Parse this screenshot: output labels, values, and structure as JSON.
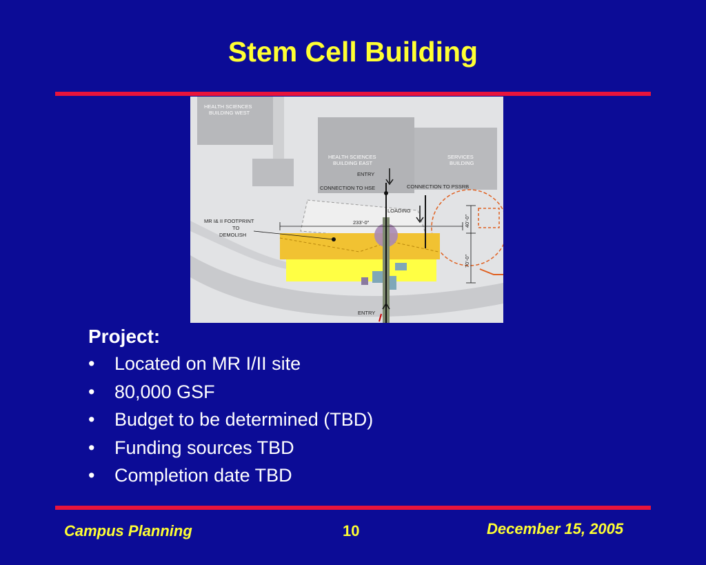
{
  "slide": {
    "title": "Stem Cell Building"
  },
  "site_plan": {
    "labels": {
      "hs_west_1": "HEALTH SCIENCES",
      "hs_west_2": "BUILDING WEST",
      "hs_east_1": "HEALTH SCIENCES",
      "hs_east_2": "BUILDING EAST",
      "services_1": "SERVICES",
      "services_2": "BUILDING",
      "entry_top": "ENTRY",
      "connection_hse": "CONNECTION TO HSE",
      "connection_pssrb": "CONNECTION TO PSSRB",
      "loading": "LOADING",
      "footprint_1": "MR I& II FOOTPRINT",
      "footprint_2": "TO",
      "footprint_3": "DEMOLISH",
      "dimension_width": "233'-0\"",
      "dimension_right_1": "40'-0\"",
      "dimension_right_2": "70'-0\"",
      "entry_bottom": "ENTRY"
    }
  },
  "project": {
    "heading": "Project:",
    "bullet_glyph": "•",
    "items": [
      "Located on MR I/II site",
      "80,000 GSF",
      "Budget to be determined (TBD)",
      "Funding sources TBD",
      "Completion date TBD"
    ]
  },
  "footer": {
    "left": "Campus Planning",
    "page_number": "10",
    "date": "December 15, 2005"
  },
  "colors": {
    "background": "#0c0c96",
    "title": "#ffff33",
    "rule": "#e8143c",
    "text": "#ffffff",
    "footer": "#ffff33"
  }
}
